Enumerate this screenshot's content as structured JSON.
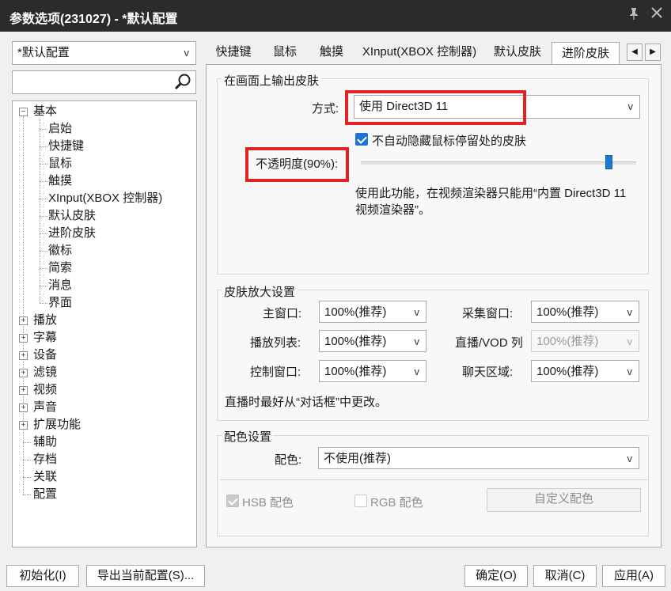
{
  "window": {
    "title": "参数选项(231027) - *默认配置",
    "pin_icon": "pin-icon",
    "close_icon": "close-icon"
  },
  "profile": {
    "selected": "*默认配置"
  },
  "search": {
    "value": ""
  },
  "tree": {
    "root": "基本",
    "children": [
      "启始",
      "快捷键",
      "鼠标",
      "触摸",
      "XInput(XBOX 控制器)",
      "默认皮肤",
      "进阶皮肤",
      "徽标",
      "简索",
      "消息",
      "界面"
    ],
    "collapsed": [
      "播放",
      "字幕",
      "设备",
      "滤镜",
      "视频",
      "声音",
      "扩展功能"
    ],
    "leaves": [
      "辅助",
      "存档",
      "关联",
      "配置"
    ]
  },
  "tabs": [
    "快捷键",
    "鼠标",
    "触摸",
    "XInput(XBOX 控制器)",
    "默认皮肤",
    "进阶皮肤"
  ],
  "output": {
    "group_title": "在画面上输出皮肤",
    "mode_label": "方式:",
    "mode_value": "使用 Direct3D 11",
    "hide_cursor_label": "不自动隐藏鼠标停留处的皮肤",
    "opacity_label": "不透明度(90%):",
    "opacity_value": 0.9,
    "note_line1": "使用此功能，在视频渲染器只能用“内置 Direct3D 11",
    "note_line2": "视频渲染器”。"
  },
  "zoom": {
    "group_title": "皮肤放大设置",
    "main_label": "主窗口:",
    "main_value": "100%(推荐)",
    "capture_label": "采集窗口:",
    "capture_value": "100%(推荐)",
    "playlist_label": "播放列表:",
    "playlist_value": "100%(推荐)",
    "vod_label": "直播/VOD 列",
    "vod_value": "100%(推荐)",
    "control_label": "控制窗口:",
    "control_value": "100%(推荐)",
    "chat_label": "聊天区域:",
    "chat_value": "100%(推荐)",
    "hint": "直播时最好从“对话框”中更改。"
  },
  "color": {
    "group_title": "配色设置",
    "label": "配色:",
    "value": "不使用(推荐)",
    "hsb_label": "HSB 配色",
    "rgb_label": "RGB 配色",
    "custom_button": "自定义配色"
  },
  "footer": {
    "init": "初始化(I)",
    "export": "导出当前配置(S)...",
    "ok": "确定(O)",
    "cancel": "取消(C)",
    "apply": "应用(A)"
  },
  "colors": {
    "titlebar": "#2b2b2b",
    "accent": "#1e79d2",
    "highlight": "#e02424"
  }
}
